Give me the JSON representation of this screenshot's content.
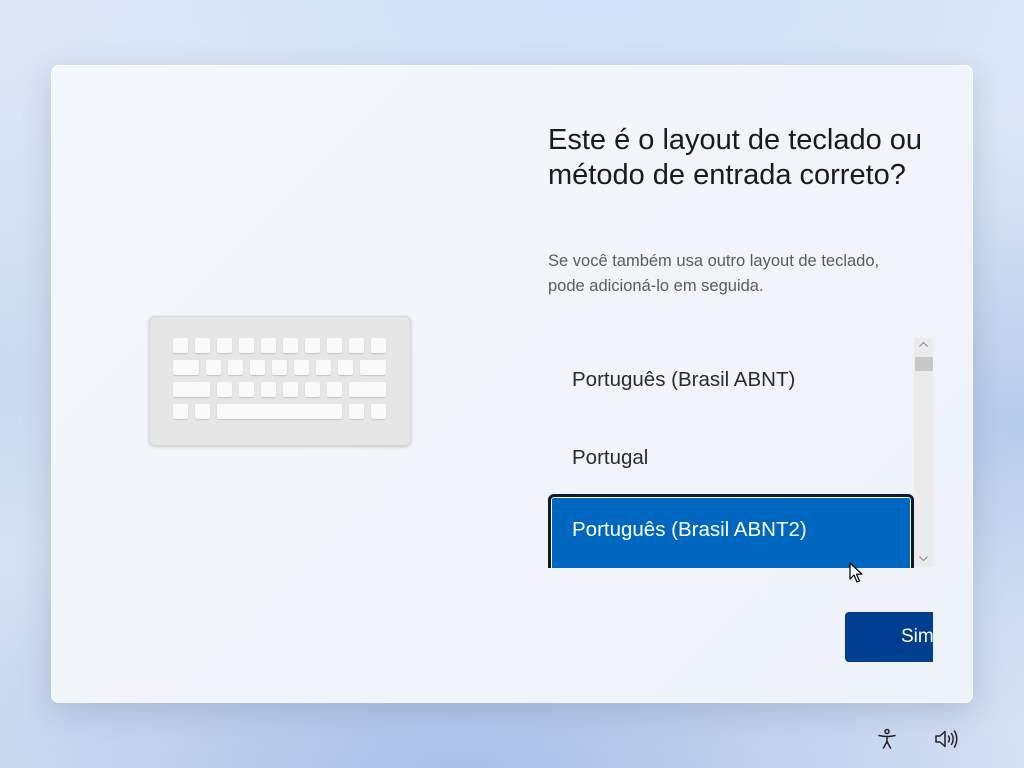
{
  "dialog": {
    "title": "Este é o layout de teclado ou método de entrada correto?",
    "subtitle": "Se você também usa outro layout de teclado, pode adicioná-lo em seguida.",
    "illustration_icon": "keyboard-icon"
  },
  "layout_list": {
    "items": [
      {
        "label": "Português (Brasil ABNT)",
        "selected": false
      },
      {
        "label": "Portugal",
        "selected": false
      },
      {
        "label": "Português (Brasil ABNT2)",
        "selected": true
      }
    ]
  },
  "actions": {
    "yes_label": "Sim"
  },
  "system_tray": {
    "accessibility_icon": "accessibility-icon",
    "volume_icon": "volume-icon"
  },
  "colors": {
    "accent": "#0067c0",
    "primary_button": "#003e92",
    "selection_border": "#0b1a2e"
  }
}
